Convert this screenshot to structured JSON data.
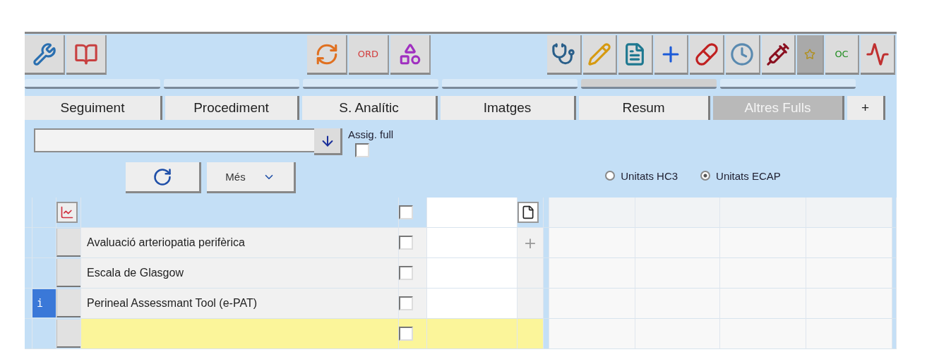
{
  "toolbar": {
    "order_label": "ORD",
    "oc_label": "OC",
    "star_pressed": true
  },
  "strips": [
    {
      "selected": false
    },
    {
      "selected": false
    },
    {
      "selected": false
    },
    {
      "selected": false
    },
    {
      "selected": true
    },
    {
      "selected": false
    }
  ],
  "tabs": [
    {
      "label": "Seguiment",
      "disabled": false
    },
    {
      "label": "Procediment",
      "disabled": false
    },
    {
      "label": "S. Analític",
      "disabled": false
    },
    {
      "label": "Imatges",
      "disabled": false
    },
    {
      "label": "Resum",
      "disabled": false
    },
    {
      "label": "Altres Fulls",
      "disabled": true
    },
    {
      "label": "+",
      "disabled": false
    }
  ],
  "filter": {
    "assign_label": "Assig. full",
    "assign_checked": false,
    "more_label": "Més"
  },
  "units": [
    {
      "label": "Unitats HC3",
      "selected": false
    },
    {
      "label": "Unitats ECAP",
      "selected": true
    }
  ],
  "grid": {
    "header_checked": false,
    "rows": [
      {
        "name": "Avaluació arteriopatia perifèrica",
        "checked": false,
        "info": false,
        "highlighted": false,
        "add_mark": "+"
      },
      {
        "name": "Escala de Glasgow",
        "checked": false,
        "info": false,
        "highlighted": false
      },
      {
        "name": "Perineal Assessmant Tool (e-PAT)",
        "checked": false,
        "info": true,
        "info_label": "i",
        "highlighted": false
      },
      {
        "checked": false,
        "info": false,
        "highlighted": true
      }
    ]
  }
}
